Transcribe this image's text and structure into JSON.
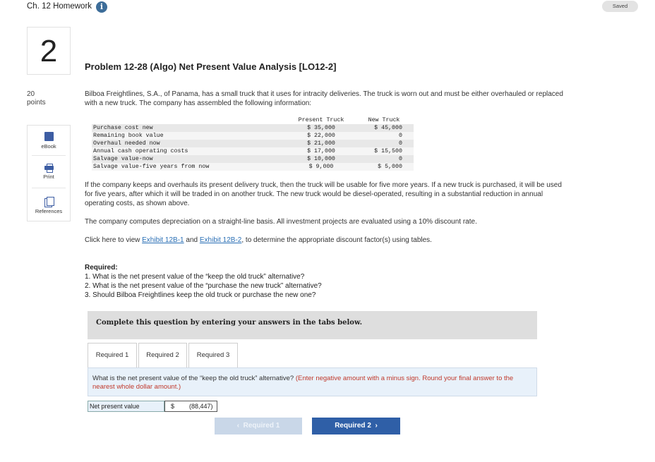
{
  "header": {
    "homework_title": "Ch. 12 Homework",
    "info_icon": "info-icon",
    "saved_label": "Saved"
  },
  "question": {
    "number": "2",
    "points_value": "20",
    "points_label": "points"
  },
  "tools": [
    {
      "label": "eBook",
      "icon": "book-icon"
    },
    {
      "label": "Print",
      "icon": "printer-icon"
    },
    {
      "label": "References",
      "icon": "references-icon"
    }
  ],
  "problem": {
    "title": "Problem 12-28 (Algo) Net Present Value Analysis [LO12-2]",
    "intro": "Bilboa Freightlines, S.A., of Panama, has a small truck that it uses for intracity deliveries. The truck is worn out and must be either overhauled or replaced with a new truck. The company has assembled the following information:",
    "table": {
      "col_present": "Present Truck",
      "col_new": "New Truck",
      "rows": [
        {
          "label": "Purchase cost new",
          "present": "$ 35,000",
          "new": "$ 45,000"
        },
        {
          "label": "Remaining book value",
          "present": "$ 22,000",
          "new": "0"
        },
        {
          "label": "Overhaul needed now",
          "present": "$ 21,000",
          "new": "0"
        },
        {
          "label": "Annual cash operating costs",
          "present": "$ 17,000",
          "new": "$ 15,500"
        },
        {
          "label": "Salvage value-now",
          "present": "$ 10,000",
          "new": "0"
        },
        {
          "label": "Salvage value-five years from now",
          "present": "$ 9,000",
          "new": "$ 5,000"
        }
      ]
    },
    "para2": "If the company keeps and overhauls its present delivery truck, then the truck will be usable for five more years. If a new truck is purchased, it will be used for five years, after which it will be traded in on another truck. The new truck would be diesel-operated, resulting in a substantial reduction in annual operating costs, as shown above.",
    "para3": "The company computes depreciation on a straight-line basis. All investment projects are evaluated using a 10% discount rate.",
    "para4_prefix": "Click here to view ",
    "exhibit1": "Exhibit 12B-1",
    "para4_and": " and ",
    "exhibit2": "Exhibit 12B-2",
    "para4_suffix": ", to determine the appropriate discount factor(s) using tables."
  },
  "required": {
    "heading": "Required:",
    "items": [
      "1. What is the net present value of the “keep the old truck” alternative?",
      "2. What is the net present value of the “purchase the new truck” alternative?",
      "3. Should Bilboa Freightlines keep the old truck or purchase the new one?"
    ]
  },
  "complete_prompt": "Complete this question by entering your answers in the tabs below.",
  "tabs": [
    {
      "label": "Required 1",
      "active": true
    },
    {
      "label": "Required 2",
      "active": false
    },
    {
      "label": "Required 3",
      "active": false
    }
  ],
  "panel": {
    "question_text": "What is the net present value of the “keep the old truck” alternative?",
    "hint": "(Enter negative amount with a minus sign. Round your final answer to the nearest whole dollar amount.)",
    "answer_label": "Net present value",
    "currency": "$",
    "answer_value": "(88,447)"
  },
  "navigation": {
    "prev_label": "Required 1",
    "next_label": "Required 2"
  }
}
